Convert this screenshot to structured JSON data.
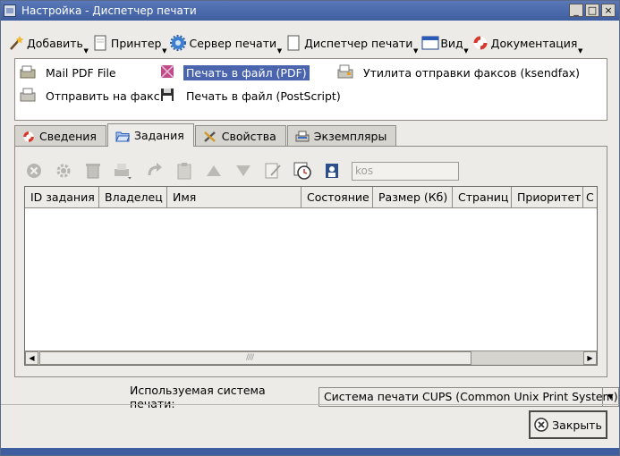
{
  "window": {
    "title": "Настройка - Диспетчер печати"
  },
  "titlebar_buttons": {
    "minimize": "_",
    "maximize": "□",
    "close": "×"
  },
  "menu": [
    {
      "label": "Добавить",
      "icon": "wand-icon"
    },
    {
      "label": "Принтер",
      "icon": "printer-doc-icon"
    },
    {
      "label": "Сервер печати",
      "icon": "server-gear-icon"
    },
    {
      "label": "Диспетчер печати",
      "icon": "document-icon"
    },
    {
      "label": "Вид",
      "icon": "window-view-icon"
    },
    {
      "label": "Документация",
      "icon": "lifebuoy-icon"
    }
  ],
  "printers": {
    "mail_pdf": "Mail PDF File",
    "print_to_pdf": "Печать в файл (PDF)",
    "fax_utility": "Утилита отправки факсов (ksendfax)",
    "send_fax": "Отправить на факс",
    "print_to_ps": "Печать в файл (PostScript)"
  },
  "tabs": {
    "info": "Сведения",
    "jobs": "Задания",
    "properties": "Свойства",
    "instances": "Экземпляры"
  },
  "jobs_toolbar": {
    "filter_value": "kos"
  },
  "jobs_table": {
    "columns": [
      "ID задания",
      "Владелец",
      "Имя",
      "Состояние",
      "Размер (Кб)",
      "Страниц",
      "Приоритет",
      "С"
    ],
    "rows": []
  },
  "print_system": {
    "label": "Используемая система печати:",
    "value": "Система печати CUPS (Common Unix Print System)"
  },
  "close_button": "Закрыть",
  "colors": {
    "title_bar": "#4a6aad",
    "selection": "#4a65ad",
    "window_bg": "#ecebe7"
  }
}
